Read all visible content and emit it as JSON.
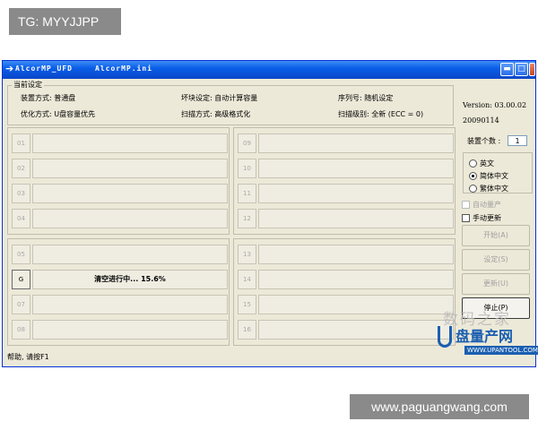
{
  "overlay": {
    "top_tag": "TG: MYYJJPP",
    "bottom_tag": "www.paguangwang.com"
  },
  "window": {
    "title_left": "AlcorMP_UFD",
    "title_right": "AlcorMP.ini"
  },
  "settings": {
    "group_title": "当前设定",
    "device_mode": "装置方式: 普通盘",
    "bad_block": "坏块设定: 自动计算容量",
    "serial": "序列号: 随机设定",
    "optimize": "优化方式: U盘容量优先",
    "scan_mode": "扫描方式: 高级格式化",
    "scan_level": "扫描级别: 全新 (ECC = 0)"
  },
  "side": {
    "version": "Version: 03.00.02",
    "date": "20090114",
    "device_count_label": "装置个数 :",
    "device_count": "1",
    "languages": [
      {
        "label": "英文",
        "selected": false
      },
      {
        "label": "简体中文",
        "selected": true
      },
      {
        "label": "繁体中文",
        "selected": false
      }
    ],
    "auto_produce": "自动量产",
    "manual_update": "手动更新",
    "buttons": {
      "start": "开始(A)",
      "settings": "设定(S)",
      "update": "更新(U)",
      "stop": "停止(P)"
    }
  },
  "ports": {
    "left_top": [
      {
        "id": "01",
        "text": ""
      },
      {
        "id": "02",
        "text": ""
      },
      {
        "id": "03",
        "text": ""
      },
      {
        "id": "04",
        "text": ""
      }
    ],
    "right_top": [
      {
        "id": "09",
        "text": ""
      },
      {
        "id": "10",
        "text": ""
      },
      {
        "id": "11",
        "text": ""
      },
      {
        "id": "12",
        "text": ""
      }
    ],
    "left_bottom": [
      {
        "id": "05",
        "text": ""
      },
      {
        "id": "G",
        "text": "清空进行中... 15.6%",
        "active": true
      },
      {
        "id": "07",
        "text": ""
      },
      {
        "id": "08",
        "text": ""
      }
    ],
    "right_bottom": [
      {
        "id": "13",
        "text": ""
      },
      {
        "id": "14",
        "text": ""
      },
      {
        "id": "15",
        "text": ""
      },
      {
        "id": "16",
        "text": ""
      }
    ]
  },
  "status": {
    "help": "帮助, 请按F1"
  },
  "watermark": {
    "top": "数码之家",
    "main": "盘量产网",
    "url": "WWW.UPANTOOL.COM"
  }
}
